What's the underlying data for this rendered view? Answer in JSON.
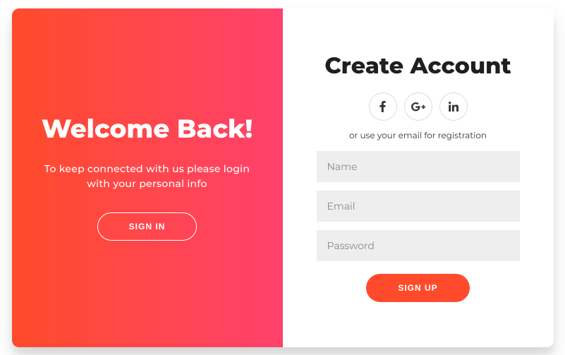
{
  "overlay": {
    "title": "Welcome Back!",
    "subtitle": "To keep connected with us please login with your personal info",
    "button_label": "Sign In"
  },
  "form": {
    "title": "Create Account",
    "hint": "or use your email for registration",
    "fields": {
      "name_placeholder": "Name",
      "email_placeholder": "Email",
      "password_placeholder": "Password"
    },
    "submit_label": "Sign Up"
  },
  "social": {
    "facebook": "facebook",
    "google": "google-plus",
    "linkedin": "linkedin"
  }
}
